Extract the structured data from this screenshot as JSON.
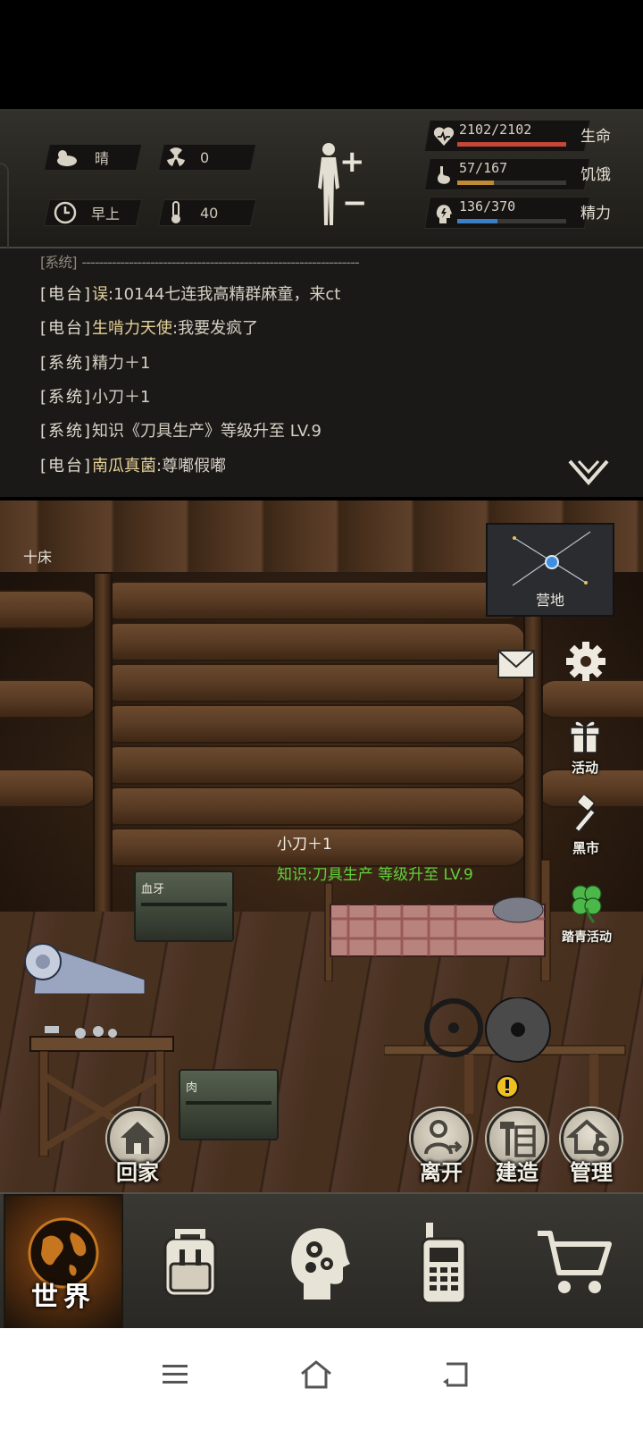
{
  "status": {
    "weather": "晴",
    "radiation": "0",
    "time_of_day": "早上",
    "temperature": "40"
  },
  "stats": [
    {
      "value": "2102/2102",
      "label": "生命",
      "fill": 1.0,
      "color": "#c4473a"
    },
    {
      "value": "57/167",
      "label": "饥饿",
      "fill": 0.34,
      "color": "#c08a36"
    },
    {
      "value": "136/370",
      "label": "精力",
      "fill": 0.37,
      "color": "#3d7fc4"
    }
  ],
  "chat": {
    "partial_tag": "[系统]",
    "partial_text": "-----------------------------------------------------------------",
    "lines": [
      {
        "tag": "[电台]",
        "name": "误",
        "text": ":10144七连我高精群麻童，来ct"
      },
      {
        "tag": "[电台]",
        "name": "生啃力天使",
        "text": ":我要发疯了"
      },
      {
        "tag": "[系统]",
        "name": "",
        "text": "精力＋1"
      },
      {
        "tag": "[系统]",
        "name": "",
        "text": "小刀＋1"
      },
      {
        "tag": "[系统]",
        "name": "",
        "text": "知识《刀具生产》等级升至 LV.9"
      },
      {
        "tag": "[电台]",
        "name": "南瓜真菌",
        "text": ":尊嘟假嘟"
      }
    ]
  },
  "scene": {
    "bed_label": "十床",
    "minimap_label": "营地",
    "float_1": "小刀＋1",
    "float_2": "知识:刀具生产 等级升至 LV.9",
    "crate_1": "血牙",
    "crate_2": "肉"
  },
  "side_buttons": {
    "activity": "活动",
    "black_market": "黑市",
    "spring_event": "踏青活动"
  },
  "action_buttons": {
    "home": "回家",
    "leave": "离开",
    "build": "建造",
    "manage": "管理"
  },
  "bottom_nav": {
    "world": "世界",
    "icons": [
      "backpack-icon",
      "skills-head-icon",
      "radio-icon",
      "shop-cart-icon"
    ]
  }
}
